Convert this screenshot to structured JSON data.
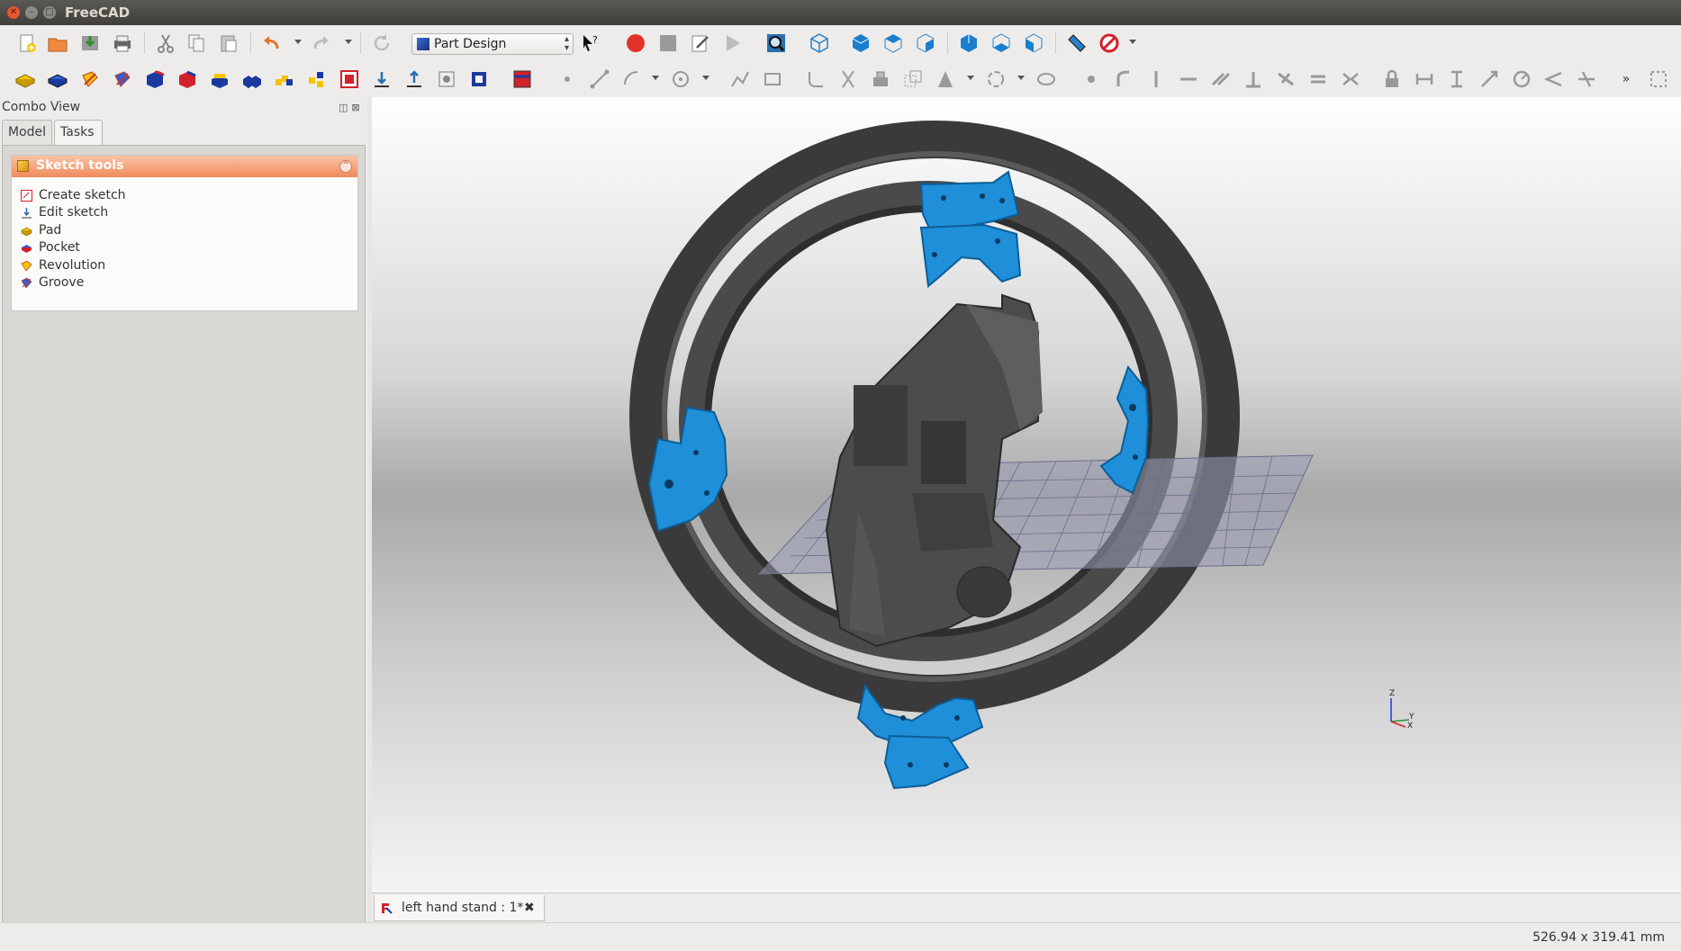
{
  "window": {
    "title": "FreeCAD"
  },
  "toolbar": {
    "workbench": "Part Design"
  },
  "combo_view": {
    "title": "Combo View",
    "tabs": [
      {
        "label": "Model",
        "active": false
      },
      {
        "label": "Tasks",
        "active": true
      }
    ],
    "task_panel": {
      "header": "Sketch tools",
      "items": [
        {
          "label": "Create sketch",
          "icon": "create-sketch-icon"
        },
        {
          "label": "Edit sketch",
          "icon": "edit-sketch-icon"
        },
        {
          "label": "Pad",
          "icon": "pad-icon"
        },
        {
          "label": "Pocket",
          "icon": "pocket-icon"
        },
        {
          "label": "Revolution",
          "icon": "revolution-icon"
        },
        {
          "label": "Groove",
          "icon": "groove-icon"
        }
      ]
    }
  },
  "document_tab": {
    "label": "left hand stand : 1*"
  },
  "status_bar": {
    "dimensions": "526.94 x 319.41 mm"
  },
  "axis_indicator": {
    "x": "X",
    "y": "Y",
    "z": "Z"
  },
  "colors": {
    "accent_part": "#1e8fd8",
    "model_gray": "#4a4a4a",
    "task_header": "#f08a5b"
  }
}
